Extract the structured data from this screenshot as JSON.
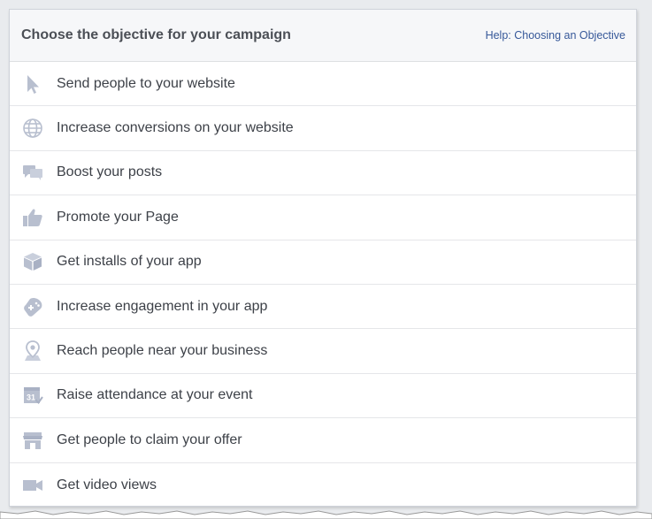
{
  "header": {
    "title": "Choose the objective for your campaign",
    "help_link": "Help: Choosing an Objective"
  },
  "objectives": [
    {
      "label": "Send people to your website",
      "icon": "cursor-icon"
    },
    {
      "label": "Increase conversions on your website",
      "icon": "globe-icon"
    },
    {
      "label": "Boost your posts",
      "icon": "speech-bubbles-icon"
    },
    {
      "label": "Promote your Page",
      "icon": "thumbs-up-icon"
    },
    {
      "label": "Get installs of your app",
      "icon": "box-icon"
    },
    {
      "label": "Increase engagement in your app",
      "icon": "gamepad-icon"
    },
    {
      "label": "Reach people near your business",
      "icon": "map-pin-icon"
    },
    {
      "label": "Raise attendance at your event",
      "icon": "calendar-icon"
    },
    {
      "label": "Get people to claim your offer",
      "icon": "storefront-icon"
    },
    {
      "label": "Get video views",
      "icon": "video-camera-icon"
    }
  ],
  "colors": {
    "icon": "#b8bfcf",
    "link": "#365899",
    "title": "#4b4f56"
  }
}
